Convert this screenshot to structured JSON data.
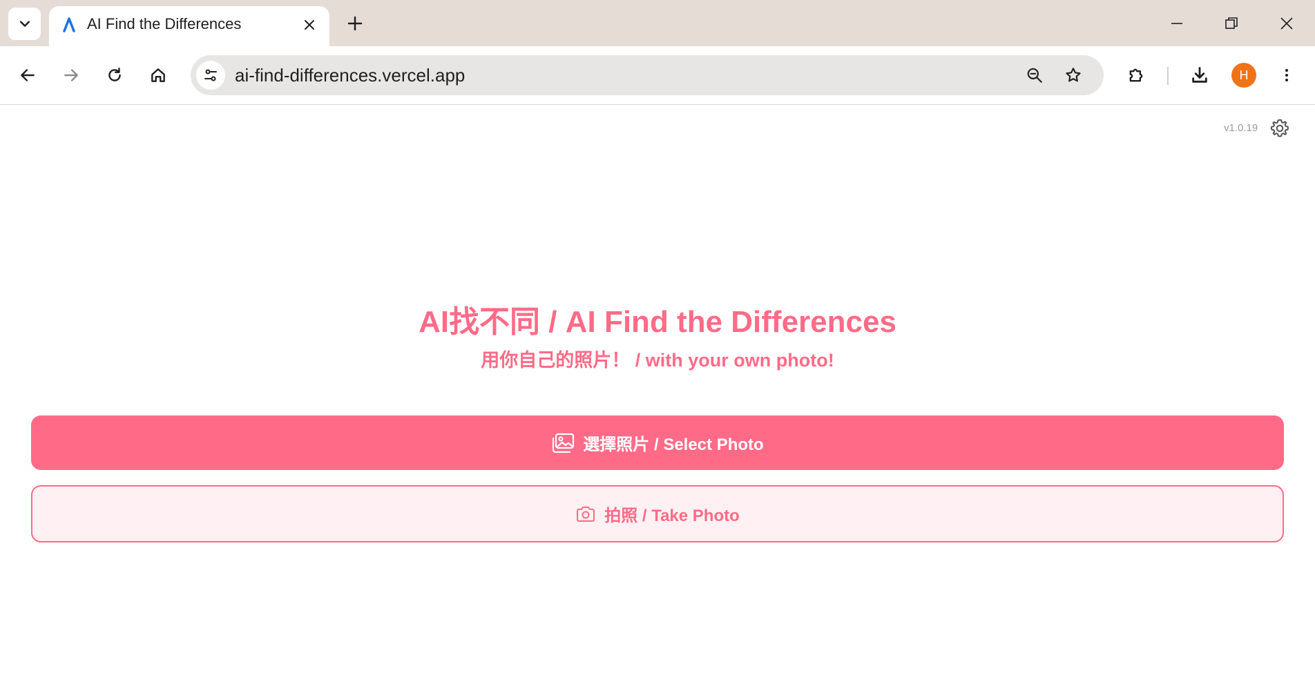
{
  "browser": {
    "tab": {
      "title": "AI Find the Differences"
    },
    "url": "ai-find-differences.vercel.app",
    "profile_initial": "H"
  },
  "app": {
    "version": "v1.0.19",
    "title": "AI找不同 / AI Find the Differences",
    "subtitle": "用你自己的照片！ / with your own photo!",
    "select_photo_label": "選擇照片 / Select Photo",
    "take_photo_label": "拍照 / Take Photo"
  },
  "icons": {
    "tab_search": "chevron-down-icon",
    "favicon": "app-logo-icon",
    "close_tab": "close-icon",
    "new_tab": "plus-icon",
    "minimize": "minimize-icon",
    "restore": "restore-icon",
    "close_window": "close-icon",
    "back": "arrow-left-icon",
    "forward": "arrow-right-icon",
    "reload": "reload-icon",
    "home": "home-icon",
    "site_info": "tune-icon",
    "zoom": "zoom-out-icon",
    "bookmark": "star-icon",
    "extensions": "puzzle-icon",
    "downloads": "download-icon",
    "menu": "more-vert-icon",
    "settings": "gear-icon",
    "select_photo": "image-icon",
    "take_photo": "camera-icon"
  },
  "colors": {
    "accent": "#ff6b87",
    "accent_light": "#fff0f3",
    "tabstrip": "#e6dcd6",
    "omnibox": "#e8e5e5",
    "avatar": "#f07318"
  }
}
